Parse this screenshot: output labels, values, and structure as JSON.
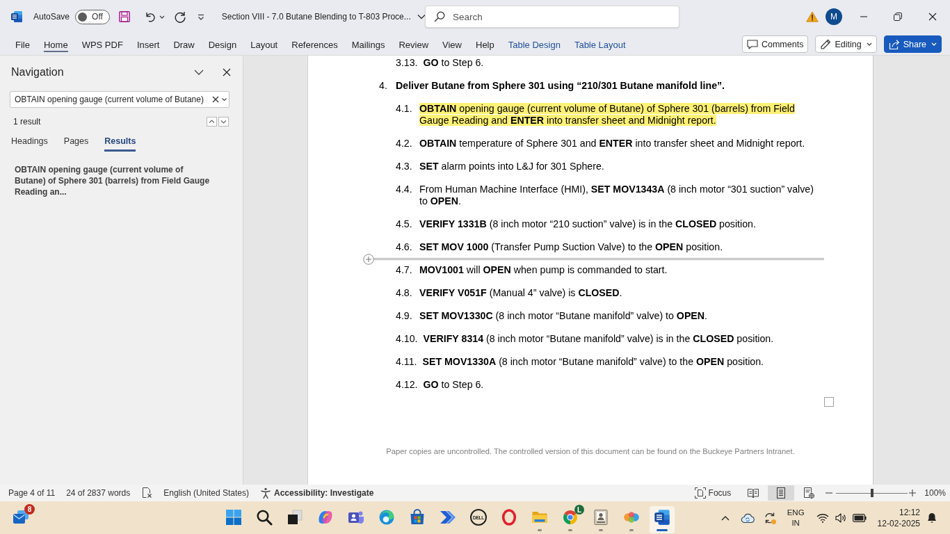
{
  "window": {
    "title": "Section VIII - 7.0 Butane Blending to T-803 Proce...",
    "autosave": {
      "label": "AutoSave",
      "toggle_label": "Off",
      "on": false
    },
    "search": {
      "placeholder": "Search"
    },
    "account": {
      "initial": "M"
    }
  },
  "ribbon": {
    "tabs": [
      {
        "label": "File",
        "kind": "standard",
        "selected": false
      },
      {
        "label": "Home",
        "kind": "standard",
        "selected": true
      },
      {
        "label": "WPS PDF",
        "kind": "standard",
        "selected": false
      },
      {
        "label": "Insert",
        "kind": "standard",
        "selected": false
      },
      {
        "label": "Draw",
        "kind": "standard",
        "selected": false
      },
      {
        "label": "Design",
        "kind": "standard",
        "selected": false
      },
      {
        "label": "Layout",
        "kind": "standard",
        "selected": false
      },
      {
        "label": "References",
        "kind": "standard",
        "selected": false
      },
      {
        "label": "Mailings",
        "kind": "standard",
        "selected": false
      },
      {
        "label": "Review",
        "kind": "standard",
        "selected": false
      },
      {
        "label": "View",
        "kind": "standard",
        "selected": false
      },
      {
        "label": "Help",
        "kind": "standard",
        "selected": false
      },
      {
        "label": "Table Design",
        "kind": "contextual",
        "selected": false
      },
      {
        "label": "Table Layout",
        "kind": "contextual",
        "selected": false
      }
    ],
    "buttons": [
      {
        "kind": "comments",
        "label": "Comments"
      },
      {
        "kind": "editing",
        "label": "Editing"
      },
      {
        "kind": "share",
        "label": "Share"
      }
    ]
  },
  "navigation": {
    "title": "Navigation",
    "query": "OBTAIN opening gauge (current volume of Butane)",
    "result_count": "1 result",
    "tabs": [
      {
        "label": "Headings",
        "selected": false
      },
      {
        "label": "Pages",
        "selected": false
      },
      {
        "label": "Results",
        "selected": true
      }
    ],
    "results": [
      "OBTAIN opening gauge (current volume of Butane) of Sphere 301 (barrels) from Field Gauge Reading an..."
    ]
  },
  "document": {
    "outline": [
      {
        "children": [
          {
            "number": "3.13.",
            "text": "**GO** to Step 6.",
            "highlighted": false,
            "insert_row_line": false
          }
        ]
      },
      {
        "number": "4.",
        "text": "Deliver Butane from Sphere 301 using “210/301 Butane manifold line”.",
        "highlighted": false,
        "children": [
          {
            "number": "4.1.",
            "text": "**OBTAIN** opening gauge (current volume of Butane) of Sphere 301 (barrels) from Field Gauge Reading and **ENTER** into transfer sheet and Midnight report.",
            "highlighted": true,
            "insert_row_line": false
          },
          {
            "number": "4.2.",
            "text": "**OBTAIN** temperature of Sphere 301 and **ENTER** into transfer sheet and Midnight report.",
            "highlighted": false,
            "insert_row_line": false
          },
          {
            "number": "4.3.",
            "text": "**SET** alarm points into L&J for 301 Sphere.",
            "highlighted": false,
            "insert_row_line": false
          },
          {
            "number": "4.4.",
            "text": "From Human Machine Interface (HMI), **SET MOV1343A** (8 inch motor “301 suction” valve) to **OPEN**.",
            "highlighted": false,
            "insert_row_line": false
          },
          {
            "number": "4.5.",
            "text": "**VERIFY 1331B** (8 inch motor “210 suction” valve) is in the **CLOSED** position.",
            "highlighted": false,
            "insert_row_line": false
          },
          {
            "number": "4.6.",
            "text": "**SET MOV 1000** (Transfer Pump Suction Valve) to the **OPEN** position.",
            "highlighted": false,
            "insert_row_line": true
          },
          {
            "number": "4.7.",
            "text": "**MOV1001** will **OPEN** when pump is commanded to start.",
            "highlighted": false,
            "insert_row_line": false
          },
          {
            "number": "4.8.",
            "text": "**VERIFY V051F** (Manual 4” valve) is **CLOSED**.",
            "highlighted": false,
            "insert_row_line": false
          },
          {
            "number": "4.9.",
            "text": "**SET MOV1330C** (8 inch motor “Butane manifold” valve) to **OPEN**.",
            "highlighted": false,
            "insert_row_line": false
          },
          {
            "number": "4.10.",
            "text": "**VERIFY 8314** (8 inch motor “Butane manifold” valve) is in the **CLOSED** position.",
            "highlighted": false,
            "insert_row_line": false
          },
          {
            "number": "4.11.",
            "text": "**SET MOV1330A** (8 inch motor “Butane manifold” valve) to the **OPEN** position.",
            "highlighted": false,
            "insert_row_line": false
          },
          {
            "number": "4.12.",
            "text": "**GO** to Step 6.",
            "highlighted": false,
            "insert_row_line": false
          }
        ]
      }
    ],
    "footer": "Paper copies are uncontrolled. The controlled version of this document can be found on the Buckeye Partners Intranet."
  },
  "status_bar": {
    "page": "Page 4 of 11",
    "words": "24 of 2837 words",
    "language": "English (United States)",
    "accessibility": "Accessibility: Investigate",
    "focus": "Focus",
    "views": [
      {
        "kind": "read",
        "selected": false
      },
      {
        "kind": "print",
        "selected": true
      },
      {
        "kind": "web",
        "selected": false
      }
    ],
    "zoom": {
      "level": 0.5,
      "reading": "100%"
    }
  },
  "taskbar": {
    "widget": {
      "badge": "8"
    },
    "apps": [
      {
        "kind": "four_squares",
        "running": false,
        "active": false
      },
      {
        "kind": "magnifier",
        "running": false,
        "active": false
      },
      {
        "kind": "stacked_windows",
        "running": false,
        "active": false
      },
      {
        "kind": "swirl",
        "running": false,
        "active": false
      },
      {
        "kind": "people_tile",
        "running": false,
        "active": false
      },
      {
        "kind": "wave_circle",
        "running": false,
        "active": false
      },
      {
        "kind": "bag",
        "running": false,
        "active": false
      },
      {
        "kind": "chevron_arrow",
        "running": false,
        "active": false
      },
      {
        "kind": "round_logo",
        "label": "DELL",
        "running": false,
        "active": false
      },
      {
        "kind": "ring",
        "running": false,
        "active": false
      },
      {
        "kind": "folder",
        "running": true,
        "active": false
      },
      {
        "kind": "segmented_circle",
        "badge": "L",
        "running": true,
        "active": false
      },
      {
        "kind": "portrait_frame",
        "running": true,
        "active": false
      },
      {
        "kind": "blobs",
        "running": true,
        "active": false
      },
      {
        "kind": "document_tile",
        "running": true,
        "active": true
      }
    ],
    "tray": {
      "language": {
        "code": "ENG",
        "region": "IN"
      },
      "time": "12:12",
      "date": "12-02-2025"
    }
  }
}
